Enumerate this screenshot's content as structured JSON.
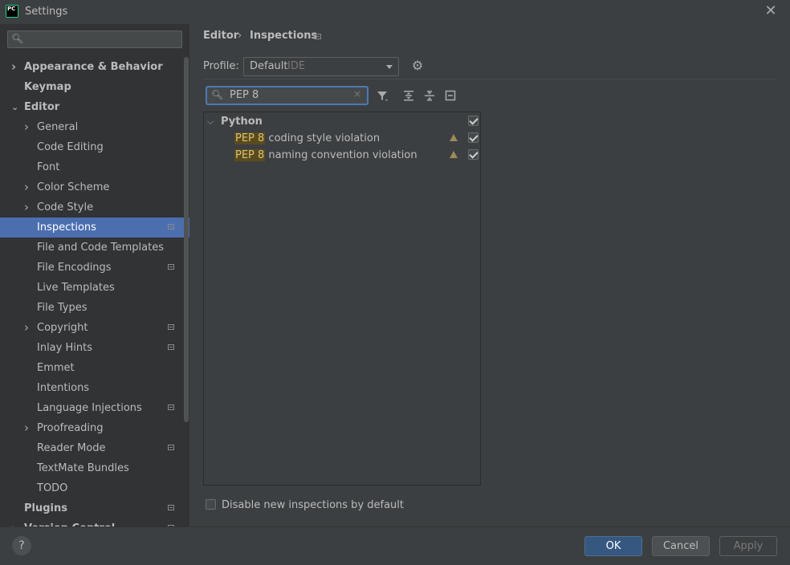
{
  "window": {
    "title": "Settings",
    "app_icon_text": "PC",
    "close_glyph": "✕"
  },
  "sidebar": {
    "search_placeholder": "",
    "items": [
      {
        "label": "Appearance & Behavior",
        "level": 0,
        "bold": true,
        "expandable": true,
        "expanded": false,
        "modified": false
      },
      {
        "label": "Keymap",
        "level": 0,
        "bold": true,
        "expandable": false,
        "modified": false
      },
      {
        "label": "Editor",
        "level": 0,
        "bold": true,
        "expandable": true,
        "expanded": true,
        "modified": false
      },
      {
        "label": "General",
        "level": 1,
        "expandable": true,
        "expanded": false,
        "modified": false
      },
      {
        "label": "Code Editing",
        "level": 1,
        "expandable": false,
        "modified": false
      },
      {
        "label": "Font",
        "level": 1,
        "expandable": false,
        "modified": false
      },
      {
        "label": "Color Scheme",
        "level": 1,
        "expandable": true,
        "expanded": false,
        "modified": false
      },
      {
        "label": "Code Style",
        "level": 1,
        "expandable": true,
        "expanded": false,
        "modified": false
      },
      {
        "label": "Inspections",
        "level": 1,
        "expandable": false,
        "modified": true,
        "selected": true
      },
      {
        "label": "File and Code Templates",
        "level": 1,
        "expandable": false,
        "modified": false
      },
      {
        "label": "File Encodings",
        "level": 1,
        "expandable": false,
        "modified": true
      },
      {
        "label": "Live Templates",
        "level": 1,
        "expandable": false,
        "modified": false
      },
      {
        "label": "File Types",
        "level": 1,
        "expandable": false,
        "modified": false
      },
      {
        "label": "Copyright",
        "level": 1,
        "expandable": true,
        "expanded": false,
        "modified": true
      },
      {
        "label": "Inlay Hints",
        "level": 1,
        "expandable": false,
        "modified": true
      },
      {
        "label": "Emmet",
        "level": 1,
        "expandable": false,
        "modified": false
      },
      {
        "label": "Intentions",
        "level": 1,
        "expandable": false,
        "modified": false
      },
      {
        "label": "Language Injections",
        "level": 1,
        "expandable": false,
        "modified": true
      },
      {
        "label": "Proofreading",
        "level": 1,
        "expandable": true,
        "expanded": false,
        "modified": false
      },
      {
        "label": "Reader Mode",
        "level": 1,
        "expandable": false,
        "modified": true
      },
      {
        "label": "TextMate Bundles",
        "level": 1,
        "expandable": false,
        "modified": false
      },
      {
        "label": "TODO",
        "level": 1,
        "expandable": false,
        "modified": false
      },
      {
        "label": "Plugins",
        "level": 0,
        "bold": true,
        "expandable": false,
        "modified": true
      },
      {
        "label": "Version Control",
        "level": 0,
        "bold": true,
        "expandable": true,
        "expanded": false,
        "modified": true
      }
    ]
  },
  "breadcrumb": {
    "parent": "Editor",
    "separator": "›",
    "current": "Inspections"
  },
  "profile": {
    "label": "Profile:",
    "value": "Default",
    "scope": "IDE"
  },
  "search": {
    "value": "PEP 8",
    "clear_glyph": "×"
  },
  "inspections": {
    "group": {
      "label": "Python",
      "checked": true
    },
    "items": [
      {
        "highlight": "PEP 8",
        "rest": " coding style violation",
        "severity": "warning",
        "checked": true
      },
      {
        "highlight": "PEP 8",
        "rest": " naming convention violation",
        "severity": "warning",
        "checked": true
      }
    ]
  },
  "disable_new": {
    "label": "Disable new inspections by default",
    "checked": false
  },
  "buttons": {
    "help": "?",
    "ok": "OK",
    "cancel": "Cancel",
    "apply": "Apply"
  },
  "colors": {
    "accent": "#4b6eaf",
    "ok_button": "#365880",
    "sidebar_bg": "#313335",
    "panel_bg": "#3c3f41",
    "highlight": "#5a4b1f"
  }
}
